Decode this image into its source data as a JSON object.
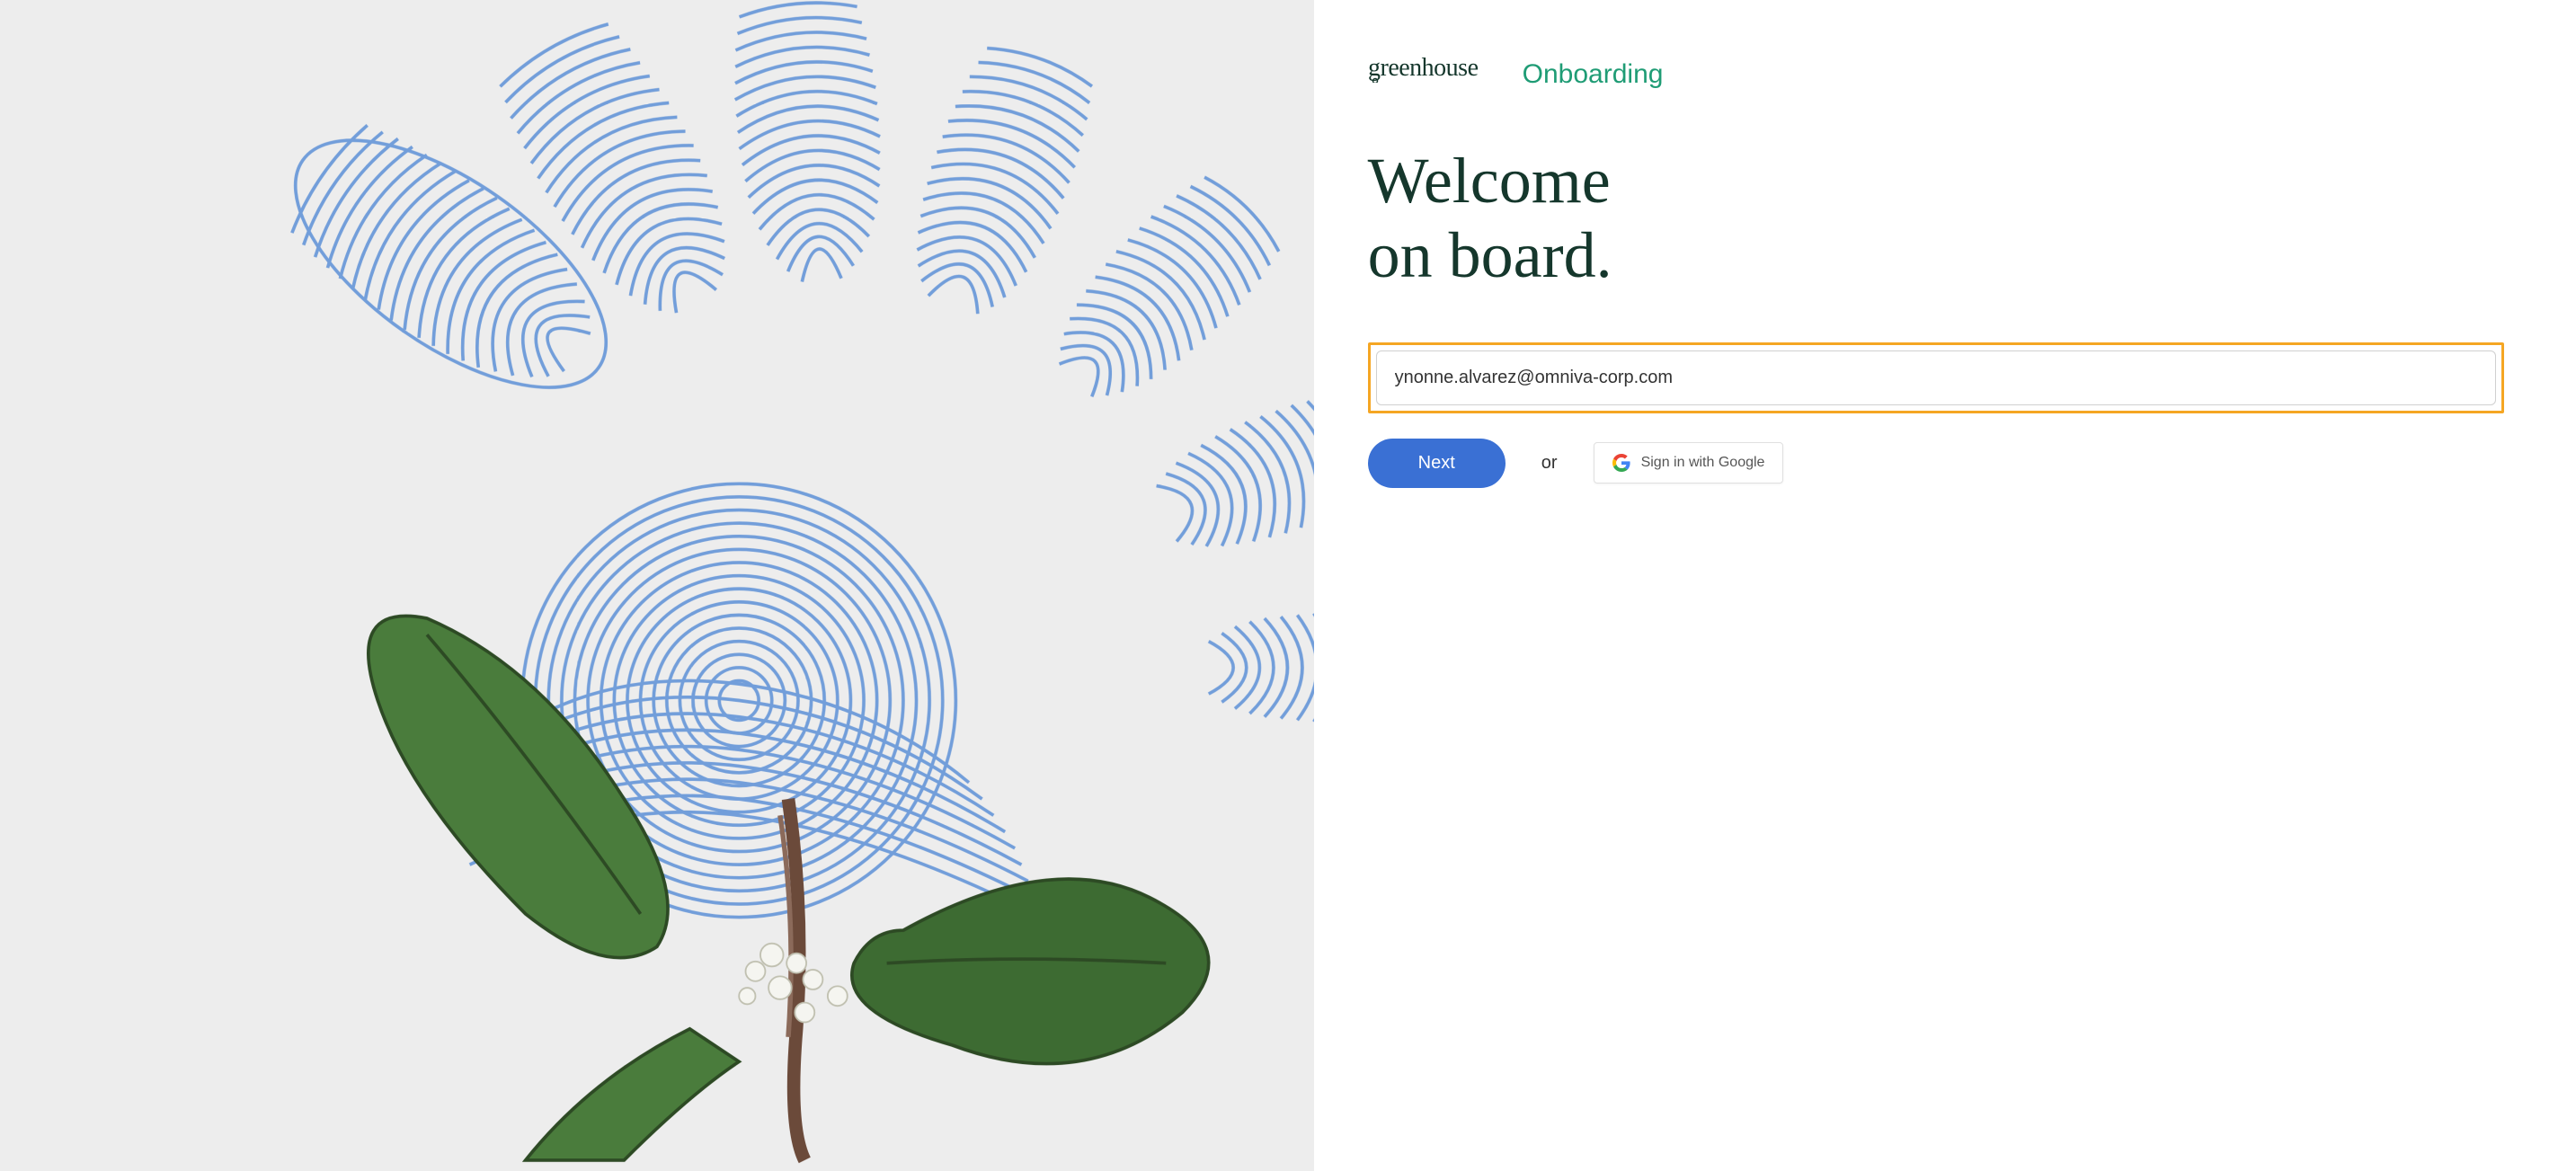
{
  "logo": {
    "brand": "greenhouse",
    "product": "Onboarding"
  },
  "heading": "Welcome\non board.",
  "form": {
    "email_value": "ynonne.alvarez@omniva-corp.com",
    "next_label": "Next",
    "or_label": "or",
    "google_signin_label": "Sign in with Google"
  }
}
